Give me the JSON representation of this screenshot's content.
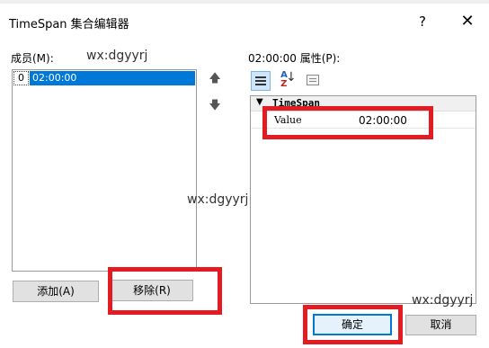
{
  "window": {
    "title": "TimeSpan 集合编辑器",
    "help_label": "?",
    "close_label": "✕"
  },
  "members": {
    "label": "成员(M):",
    "items": [
      {
        "index": "0",
        "value": "02:00:00"
      }
    ],
    "move_up_icon": "arrow-up-icon",
    "move_down_icon": "arrow-down-icon",
    "add_label": "添加(A)",
    "remove_label": "移除(R)"
  },
  "properties": {
    "label": "02:00:00 属性(P):",
    "toolbar_icons": [
      "categorized-icon",
      "alphabetical-icon",
      "property-pages-icon"
    ],
    "category": "TimeSpan",
    "rows": [
      {
        "name": "Value",
        "value": "02:00:00"
      }
    ]
  },
  "footer": {
    "ok_label": "确定",
    "cancel_label": "取消"
  },
  "watermarks": [
    "wx:dgyyrj",
    "wx:dgyyrj",
    "wx:dgyyrj"
  ],
  "colors": {
    "selection": "#0078d7",
    "highlight_box": "#e31b23",
    "button_face": "#e1e1e1"
  }
}
